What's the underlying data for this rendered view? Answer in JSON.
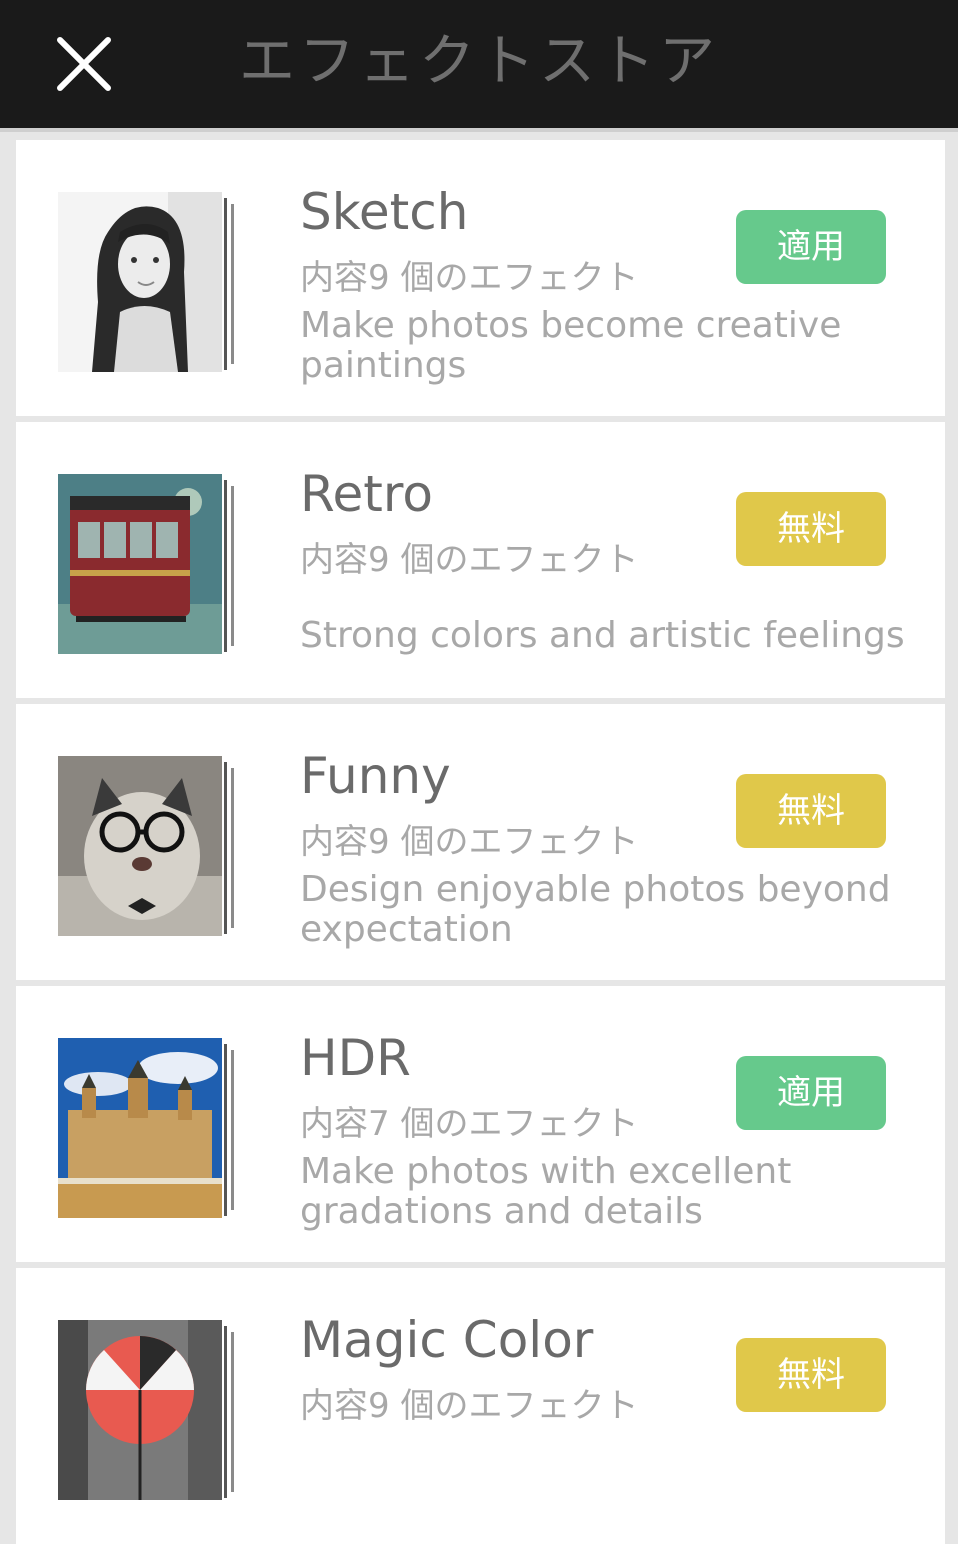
{
  "header": {
    "title": "エフェクトストア"
  },
  "colors": {
    "apply": "#66c98c",
    "free": "#e0c84a",
    "header_bg": "#1a1a1a"
  },
  "items": [
    {
      "name": "Sketch",
      "count": "内容9 個のエフェクト",
      "desc": "Make photos become creative paintings",
      "badge": "適用",
      "badge_type": "apply",
      "thumbnail": "sketch-portrait"
    },
    {
      "name": "Retro",
      "count": "内容9 個のエフェクト",
      "desc": "Strong colors and artistic feelings",
      "badge": "無料",
      "badge_type": "free",
      "thumbnail": "retro-tram"
    },
    {
      "name": "Funny",
      "count": "内容9 個のエフェクト",
      "desc": "Design enjoyable photos beyond expectation",
      "badge": "無料",
      "badge_type": "free",
      "thumbnail": "funny-cat-glasses"
    },
    {
      "name": "HDR",
      "count": "内容7 個のエフェクト",
      "desc": "Make photos with excellent gradations and details",
      "badge": "適用",
      "badge_type": "apply",
      "thumbnail": "hdr-castle"
    },
    {
      "name": "Magic Color",
      "count": "内容9 個のエフェクト",
      "desc": "",
      "badge": "無料",
      "badge_type": "free",
      "thumbnail": "magic-color-umbrella"
    }
  ]
}
